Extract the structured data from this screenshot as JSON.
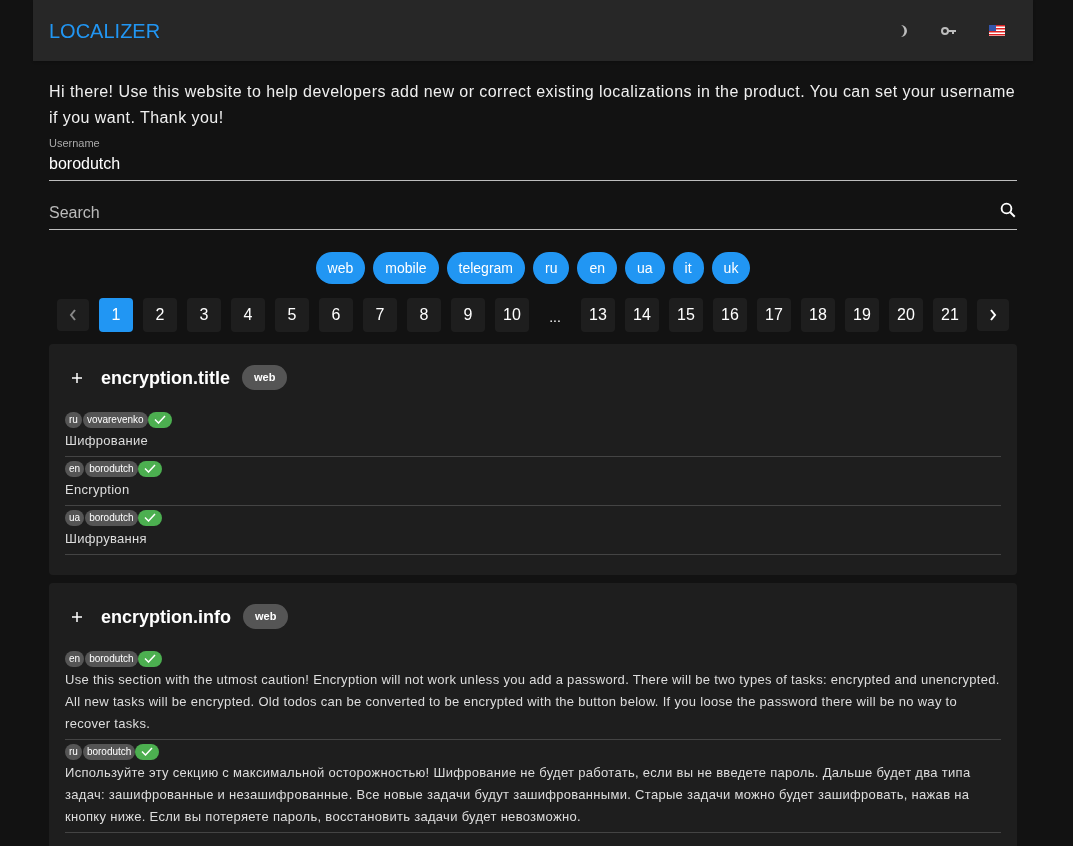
{
  "header": {
    "title": "LOCALIZER"
  },
  "intro": "Hi there! Use this website to help developers add new or correct existing localizations in the product. You can set your username if you want. Thank you!",
  "username": {
    "label": "Username",
    "value": "borodutch"
  },
  "search": {
    "placeholder": "Search"
  },
  "filters": [
    {
      "label": "web",
      "selected": true
    },
    {
      "label": "mobile",
      "selected": true
    },
    {
      "label": "telegram",
      "selected": true
    },
    {
      "label": "ru",
      "selected": true
    },
    {
      "label": "en",
      "selected": true
    },
    {
      "label": "ua",
      "selected": true
    },
    {
      "label": "it",
      "selected": true
    },
    {
      "label": "uk",
      "selected": true
    }
  ],
  "pagination": [
    {
      "label": "1",
      "selected": true,
      "kind": "page"
    },
    {
      "label": "2",
      "selected": false,
      "kind": "page"
    },
    {
      "label": "3",
      "selected": false,
      "kind": "page"
    },
    {
      "label": "4",
      "selected": false,
      "kind": "page"
    },
    {
      "label": "5",
      "selected": false,
      "kind": "page"
    },
    {
      "label": "6",
      "selected": false,
      "kind": "page"
    },
    {
      "label": "7",
      "selected": false,
      "kind": "page"
    },
    {
      "label": "8",
      "selected": false,
      "kind": "page"
    },
    {
      "label": "9",
      "selected": false,
      "kind": "page"
    },
    {
      "label": "10",
      "selected": false,
      "kind": "page"
    },
    {
      "label": "...",
      "kind": "ellipsis"
    },
    {
      "label": "13",
      "selected": false,
      "kind": "page"
    },
    {
      "label": "14",
      "selected": false,
      "kind": "page"
    },
    {
      "label": "15",
      "selected": false,
      "kind": "page"
    },
    {
      "label": "16",
      "selected": false,
      "kind": "page"
    },
    {
      "label": "17",
      "selected": false,
      "kind": "page"
    },
    {
      "label": "18",
      "selected": false,
      "kind": "page"
    },
    {
      "label": "19",
      "selected": false,
      "kind": "page"
    },
    {
      "label": "20",
      "selected": false,
      "kind": "page"
    },
    {
      "label": "21",
      "selected": false,
      "kind": "page"
    }
  ],
  "cards": [
    {
      "key": "encryption.title",
      "tag": "web",
      "variants": [
        {
          "language": "ru",
          "user": "vovarevenko",
          "approved": true,
          "text": "Шифрование"
        },
        {
          "language": "en",
          "user": "borodutch",
          "approved": true,
          "text": "Encryption"
        },
        {
          "language": "ua",
          "user": "borodutch",
          "approved": true,
          "text": "Шифрування"
        }
      ]
    },
    {
      "key": "encryption.info",
      "tag": "web",
      "variants": [
        {
          "language": "en",
          "user": "borodutch",
          "approved": true,
          "text": "Use this section with the utmost caution! Encryption will not work unless you add a password. There will be two types of tasks: encrypted and unencrypted. All new tasks will be encrypted. Old todos can be converted to be encrypted with the button below. If you loose the password there will be no way to recover tasks."
        },
        {
          "language": "ru",
          "user": "borodutch",
          "approved": true,
          "text": "Используйте эту секцию с максимальной осторожностью! Шифрование не будет работать, если вы не введете пароль. Дальше будет два типа задач: зашифрованные и незашифрованные. Все новые задачи будут зашифрованными. Старые задачи можно будет зашифровать, нажав на кнопку ниже. Если вы потеряете пароль, восстановить задачи будет невозможно."
        }
      ]
    }
  ]
}
